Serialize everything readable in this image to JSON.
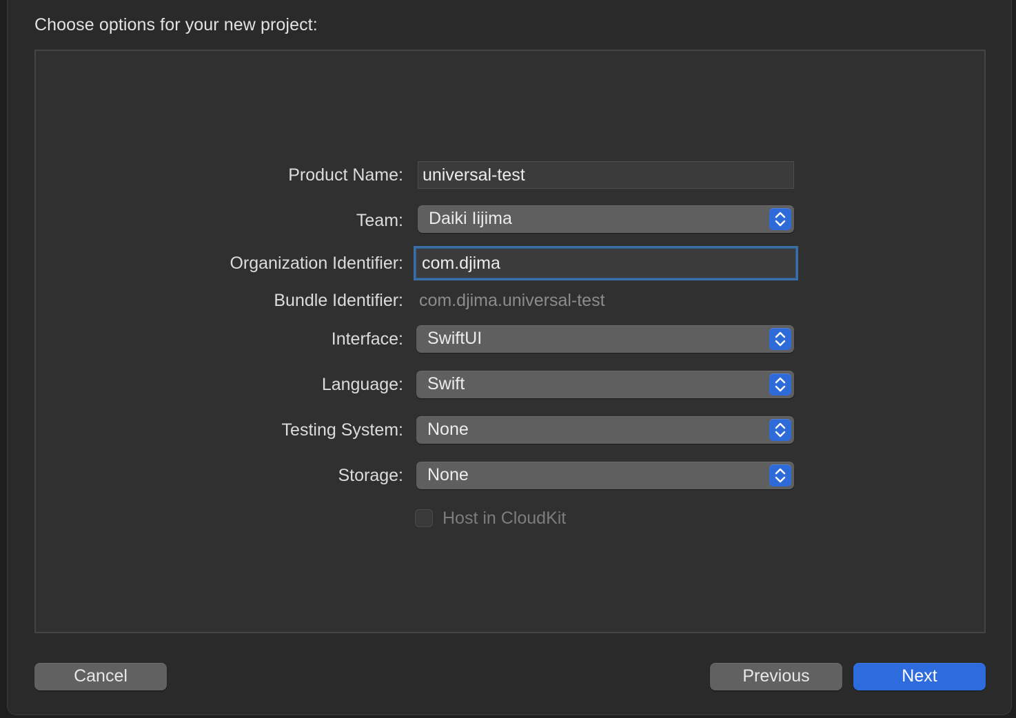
{
  "dialog": {
    "title": "Choose options for your new project:"
  },
  "form": {
    "product_name": {
      "label": "Product Name:",
      "value": "universal-test"
    },
    "team": {
      "label": "Team:",
      "value": "Daiki Iijima"
    },
    "organization_identifier": {
      "label": "Organization Identifier:",
      "value": "com.djima"
    },
    "bundle_identifier": {
      "label": "Bundle Identifier:",
      "value": "com.djima.universal-test"
    },
    "interface": {
      "label": "Interface:",
      "value": "SwiftUI"
    },
    "language": {
      "label": "Language:",
      "value": "Swift"
    },
    "testing_system": {
      "label": "Testing System:",
      "value": "None"
    },
    "storage": {
      "label": "Storage:",
      "value": "None"
    },
    "host_in_cloudkit": {
      "label": "Host in CloudKit",
      "checked": false,
      "enabled": false
    }
  },
  "buttons": {
    "cancel": "Cancel",
    "previous": "Previous",
    "next": "Next"
  },
  "colors": {
    "accent": "#2e6bdc",
    "focus_ring": "#3b6ea5",
    "sheet_background": "#2a2a2a",
    "panel_background": "#303030"
  },
  "icons": {
    "popup_indicator": "chevron-up-down-icon"
  }
}
